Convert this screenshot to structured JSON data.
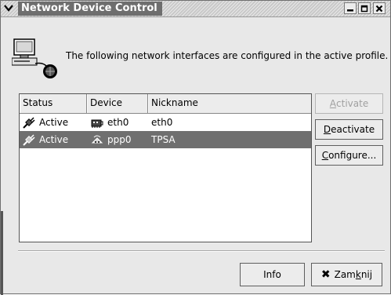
{
  "window": {
    "title": "Network Device Control",
    "controls": {
      "minimize": "–",
      "maximize": "□",
      "close": "✕"
    }
  },
  "header": {
    "message": "The following network interfaces are configured in the active profile."
  },
  "table": {
    "columns": [
      "Status",
      "Device",
      "Nickname"
    ],
    "rows": [
      {
        "status": "Active",
        "device": "eth0",
        "nickname": "eth0",
        "selected": false,
        "device_icon": "ethernet-card-icon"
      },
      {
        "status": "Active",
        "device": "ppp0",
        "nickname": "TPSA",
        "selected": true,
        "device_icon": "modem-icon"
      }
    ]
  },
  "buttons": {
    "activate": {
      "mnemonic": "A",
      "rest": "ctivate",
      "enabled": false
    },
    "deactivate": {
      "mnemonic": "D",
      "rest": "eactivate",
      "enabled": true
    },
    "configure": {
      "mnemonic": "C",
      "rest": "onfigure...",
      "enabled": true
    },
    "info": "Info",
    "close": {
      "pre": "Zam",
      "mnemonic": "k",
      "post": "nij"
    }
  },
  "colors": {
    "selection": "#6f6f6f",
    "title_bg": "#6e6e6e",
    "window_bg": "#e8e8e8"
  }
}
